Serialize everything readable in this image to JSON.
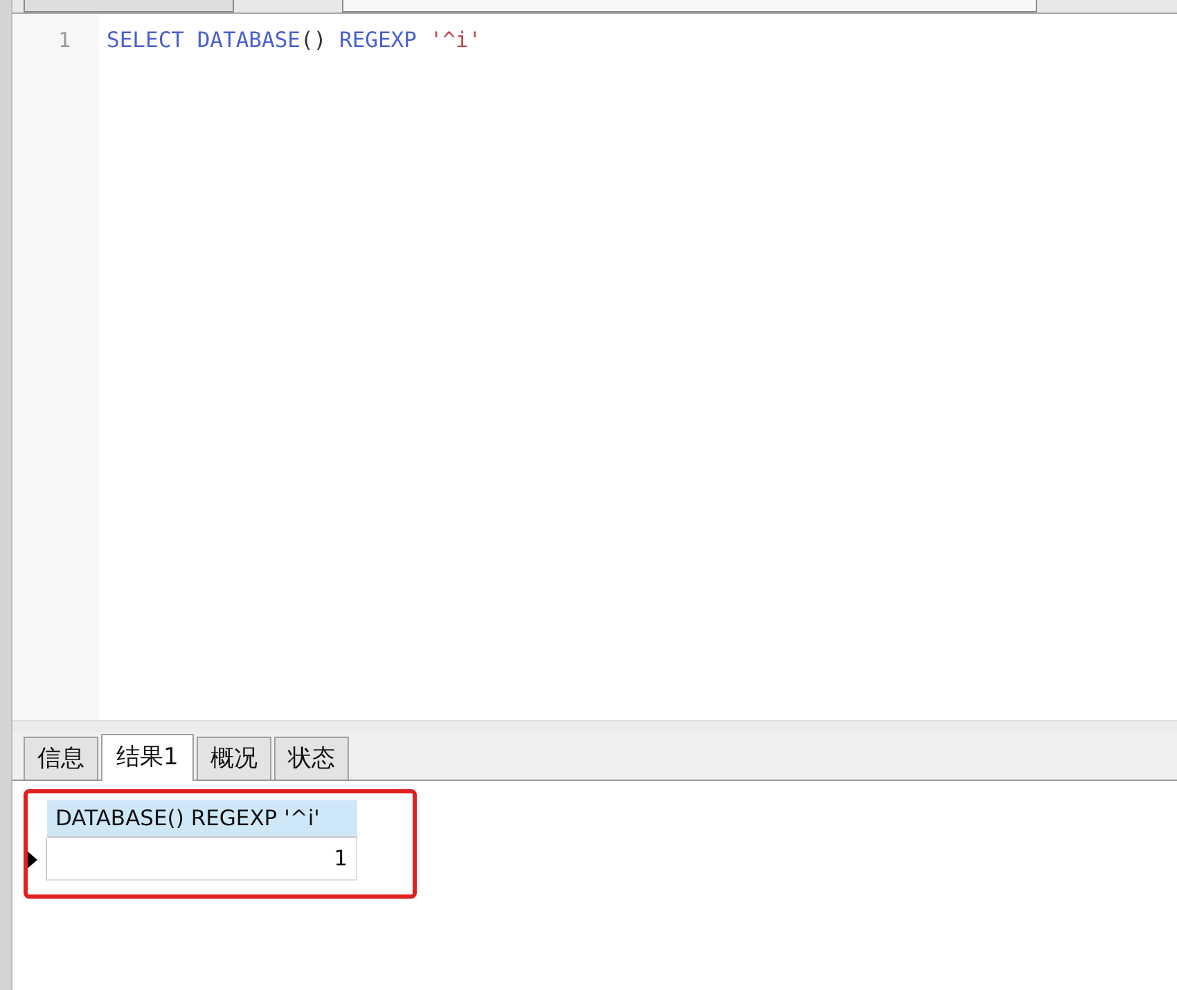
{
  "editor": {
    "lines": [
      {
        "number": "1",
        "tokens": [
          {
            "text": "SELECT ",
            "kind": "keyword"
          },
          {
            "text": "DATABASE",
            "kind": "keyword"
          },
          {
            "text": "() ",
            "kind": "plain"
          },
          {
            "text": "REGEXP ",
            "kind": "keyword"
          },
          {
            "text": "'^i'",
            "kind": "string"
          }
        ]
      }
    ]
  },
  "result_tabs": [
    {
      "label": "信息",
      "selected": false
    },
    {
      "label": "结果1",
      "selected": true
    },
    {
      "label": "概况",
      "selected": false
    },
    {
      "label": "状态",
      "selected": false
    }
  ],
  "result_grid": {
    "columns": [
      "DATABASE() REGEXP '^i'"
    ],
    "rows": [
      {
        "cells": [
          "1"
        ],
        "selected": true
      }
    ],
    "highlighted": true
  }
}
